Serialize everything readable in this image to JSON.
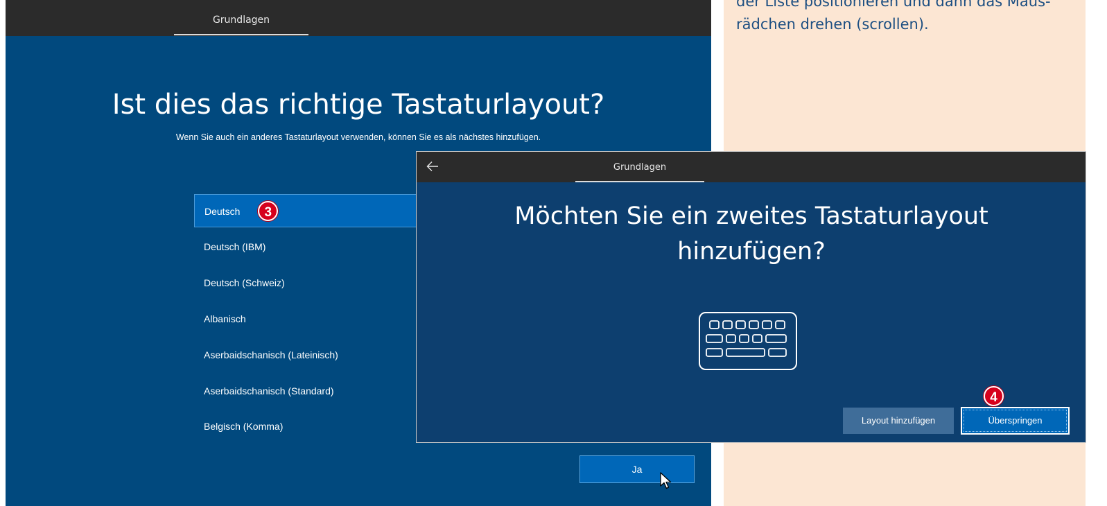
{
  "note": {
    "lines": [
      "der Liste positionieren und dann das Maus-",
      "rädchen drehen (scrollen)."
    ]
  },
  "screen1": {
    "tab": "Grundlagen",
    "title": "Ist dies das richtige Tastaturlayout?",
    "subtitle": "Wenn Sie auch ein anderes Tastaturlayout verwenden, können Sie es als nächstes hinzufügen.",
    "layouts": [
      "Deutsch",
      "Deutsch (IBM)",
      "Deutsch (Schweiz)",
      "Albanisch",
      "Aserbaidschanisch (Lateinisch)",
      "Aserbaidschanisch (Standard)",
      "Belgisch (Komma)"
    ],
    "selected_index": 0,
    "step_badge": "3",
    "confirm_label": "Ja"
  },
  "screen2": {
    "tab": "Grundlagen",
    "title_line1": "Möchten Sie ein zweites Tastaturlayout",
    "title_line2": "hinzufügen?",
    "add_label": "Layout hinzufügen",
    "skip_label": "Überspringen",
    "step_badge": "4"
  },
  "colors": {
    "oobe_blue": "#01497e",
    "oobe_blue_dark": "#0d3f6f",
    "accent": "#0067b8",
    "badge_red": "#d6001c",
    "note_bg": "#fce6d3",
    "note_text": "#1d4f82"
  },
  "icons": {
    "back": "arrow-left-icon",
    "keyboard": "keyboard-icon",
    "cursor": "mouse-pointer-icon"
  }
}
